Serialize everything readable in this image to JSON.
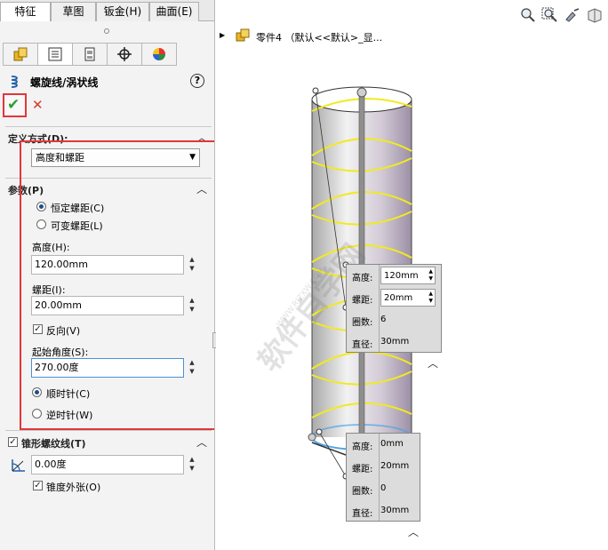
{
  "tabs": [
    "特征",
    "草图",
    "钣金(H)",
    "曲面(E)"
  ],
  "panel": {
    "title": "螺旋线/涡状线",
    "help": "?",
    "ok_mark": "✔",
    "cancel_mark": "✕"
  },
  "definition": {
    "header": "定义方式(D):",
    "selected": "高度和螺距"
  },
  "parameters": {
    "header": "参数(P)",
    "constant_pitch": "恒定螺距(C)",
    "variable_pitch": "可变螺距(L)",
    "height_label": "高度(H):",
    "height_value": "120.00mm",
    "pitch_label": "螺距(I):",
    "pitch_value": "20.00mm",
    "reverse_label": "反向(V)",
    "start_angle_label": "起始角度(S):",
    "start_angle_value": "270.00度",
    "clockwise": "顺时针(C)",
    "counterclockwise": "逆时针(W)"
  },
  "taper": {
    "header": "锥形螺纹线(T)",
    "angle_value": "0.00度",
    "outward_label": "锥度外张(O)"
  },
  "viewport": {
    "tree_label": "零件4 （默认<<默认>_显...",
    "watermark": "软件自学网",
    "watermark_sub": "WWW.RJZXW.COM",
    "callout_top": {
      "height_key": "高度:",
      "height_val": "120mm",
      "pitch_key": "螺距:",
      "pitch_val": "20mm",
      "turns_key": "圈数:",
      "turns_val": "6",
      "diam_key": "直径:",
      "diam_val": "30mm"
    },
    "callout_bottom": {
      "height_key": "高度:",
      "height_val": "0mm",
      "pitch_key": "螺距:",
      "pitch_val": "20mm",
      "turns_key": "圈数:",
      "turns_val": "0",
      "diam_key": "直径:",
      "diam_val": "30mm"
    }
  },
  "colors": {
    "accent_red": "#e3353b",
    "helix_yellow": "#f2ea1f",
    "helix_blue": "#4aa3e6",
    "ok_green": "#2e9e2e"
  }
}
